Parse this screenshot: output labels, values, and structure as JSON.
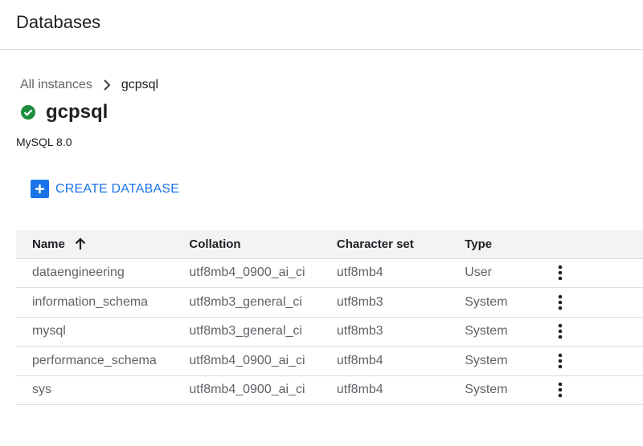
{
  "header": {
    "title": "Databases"
  },
  "breadcrumb": {
    "root": "All instances",
    "current": "gcpsql"
  },
  "instance": {
    "name": "gcpsql",
    "version": "MySQL 8.0",
    "status_color": "#1e8e3e"
  },
  "actions": {
    "create_label": "CREATE DATABASE",
    "accent": "#1a73e8"
  },
  "table": {
    "columns": {
      "name": "Name",
      "collation": "Collation",
      "charset": "Character set",
      "type": "Type"
    },
    "sort": "Name ascending",
    "rows": [
      {
        "name": "dataengineering",
        "collation": "utf8mb4_0900_ai_ci",
        "charset": "utf8mb4",
        "type": "User"
      },
      {
        "name": "information_schema",
        "collation": "utf8mb3_general_ci",
        "charset": "utf8mb3",
        "type": "System"
      },
      {
        "name": "mysql",
        "collation": "utf8mb3_general_ci",
        "charset": "utf8mb3",
        "type": "System"
      },
      {
        "name": "performance_schema",
        "collation": "utf8mb4_0900_ai_ci",
        "charset": "utf8mb4",
        "type": "System"
      },
      {
        "name": "sys",
        "collation": "utf8mb4_0900_ai_ci",
        "charset": "utf8mb4",
        "type": "System"
      }
    ]
  }
}
